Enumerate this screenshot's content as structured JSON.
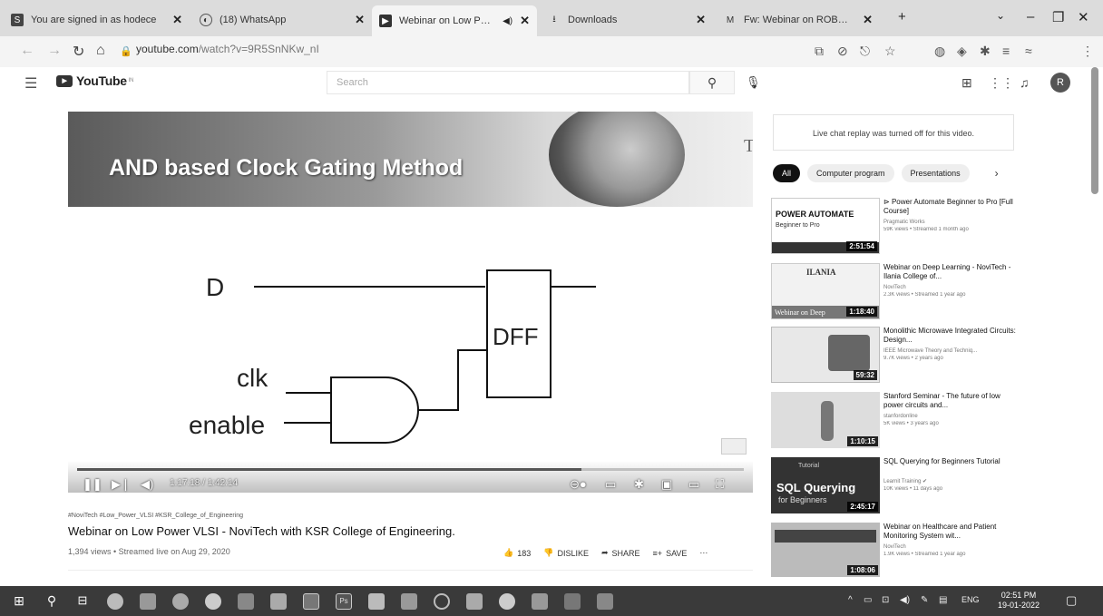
{
  "browser": {
    "tabs": [
      {
        "label": "You are signed in as hodece",
        "icon": "site-icon"
      },
      {
        "label": "(18) WhatsApp",
        "icon": "whatsapp-icon"
      },
      {
        "label": "Webinar on Low Power",
        "icon": "youtube-icon",
        "active": true
      },
      {
        "label": "Downloads",
        "icon": "download-icon"
      },
      {
        "label": "Fw: Webinar on ROBOTICS",
        "icon": "gmail-icon"
      }
    ],
    "url_host": "youtube.com",
    "url_path": "/watch?v=9R5SnNKw_nI"
  },
  "youtube": {
    "logo": "YouTube",
    "logo_sup": "IN",
    "search_placeholder": "Search",
    "avatar_letter": "R"
  },
  "video": {
    "slide_title": "AND based Clock Gating Method",
    "slide_brand": "Tech",
    "diagram": {
      "d": "D",
      "clk": "clk",
      "enable": "enable",
      "dff": "DFF"
    },
    "time": "1:17:18 / 1:42:14",
    "progress": 0.756,
    "tags": "#NoviTech #Low_Power_VLSI #KSR_College_of_Engineering",
    "title": "Webinar on Low Power VLSI - NoviTech with KSR College of Engineering.",
    "meta": "1,394 views • Streamed live on Aug 29, 2020",
    "likes": "183",
    "dislike": "DISLIKE",
    "share": "SHARE",
    "save": "SAVE"
  },
  "sidebar": {
    "chat_notice": "Live chat replay was turned off for this video.",
    "chips": [
      "All",
      "Computer program",
      "Presentations"
    ],
    "recs": [
      {
        "title": "Power Automate Beginner to Pro [Full Course]",
        "channel": "Pragmatic Works",
        "meta": "59K views • Streamed 1 month ago",
        "duration": "2:51:54",
        "thumb_text": "POWER AUTOMATE",
        "thumb_sub": "Beginner to Pro"
      },
      {
        "title": "Webinar on Deep Learning - NoviTech - Ilania College of...",
        "channel": "NoviTech",
        "meta": "2.3K views • Streamed 1 year ago",
        "duration": "1:18:40",
        "thumb_text": "ILANIA",
        "thumb_sub": "Webinar on Deep"
      },
      {
        "title": "Monolithic Microwave Integrated Circuits: Design...",
        "channel": "IEEE Microwave Theory and Techniq...",
        "meta": "9.7K views • 2 years ago",
        "duration": "59:32",
        "thumb_text": "",
        "thumb_sub": ""
      },
      {
        "title": "Stanford Seminar - The future of low power circuits and...",
        "channel": "stanfordonline",
        "meta": "5K views • 3 years ago",
        "duration": "1:10:15",
        "thumb_text": "",
        "thumb_sub": ""
      },
      {
        "title": "SQL Querying for Beginners Tutorial",
        "channel": "Learnit Training",
        "meta": "10K views • 11 days ago",
        "duration": "2:45:17",
        "thumb_text": "SQL Querying",
        "thumb_sub": "for Beginners"
      },
      {
        "title": "Webinar on Healthcare and Patient Monitoring System wit...",
        "channel": "NoviTech",
        "meta": "1.9K views • Streamed 1 year ago",
        "duration": "1:08:06",
        "thumb_text": "",
        "thumb_sub": ""
      }
    ]
  },
  "taskbar": {
    "lang": "ENG",
    "time": "02:51 PM",
    "date": "19-01-2022"
  }
}
